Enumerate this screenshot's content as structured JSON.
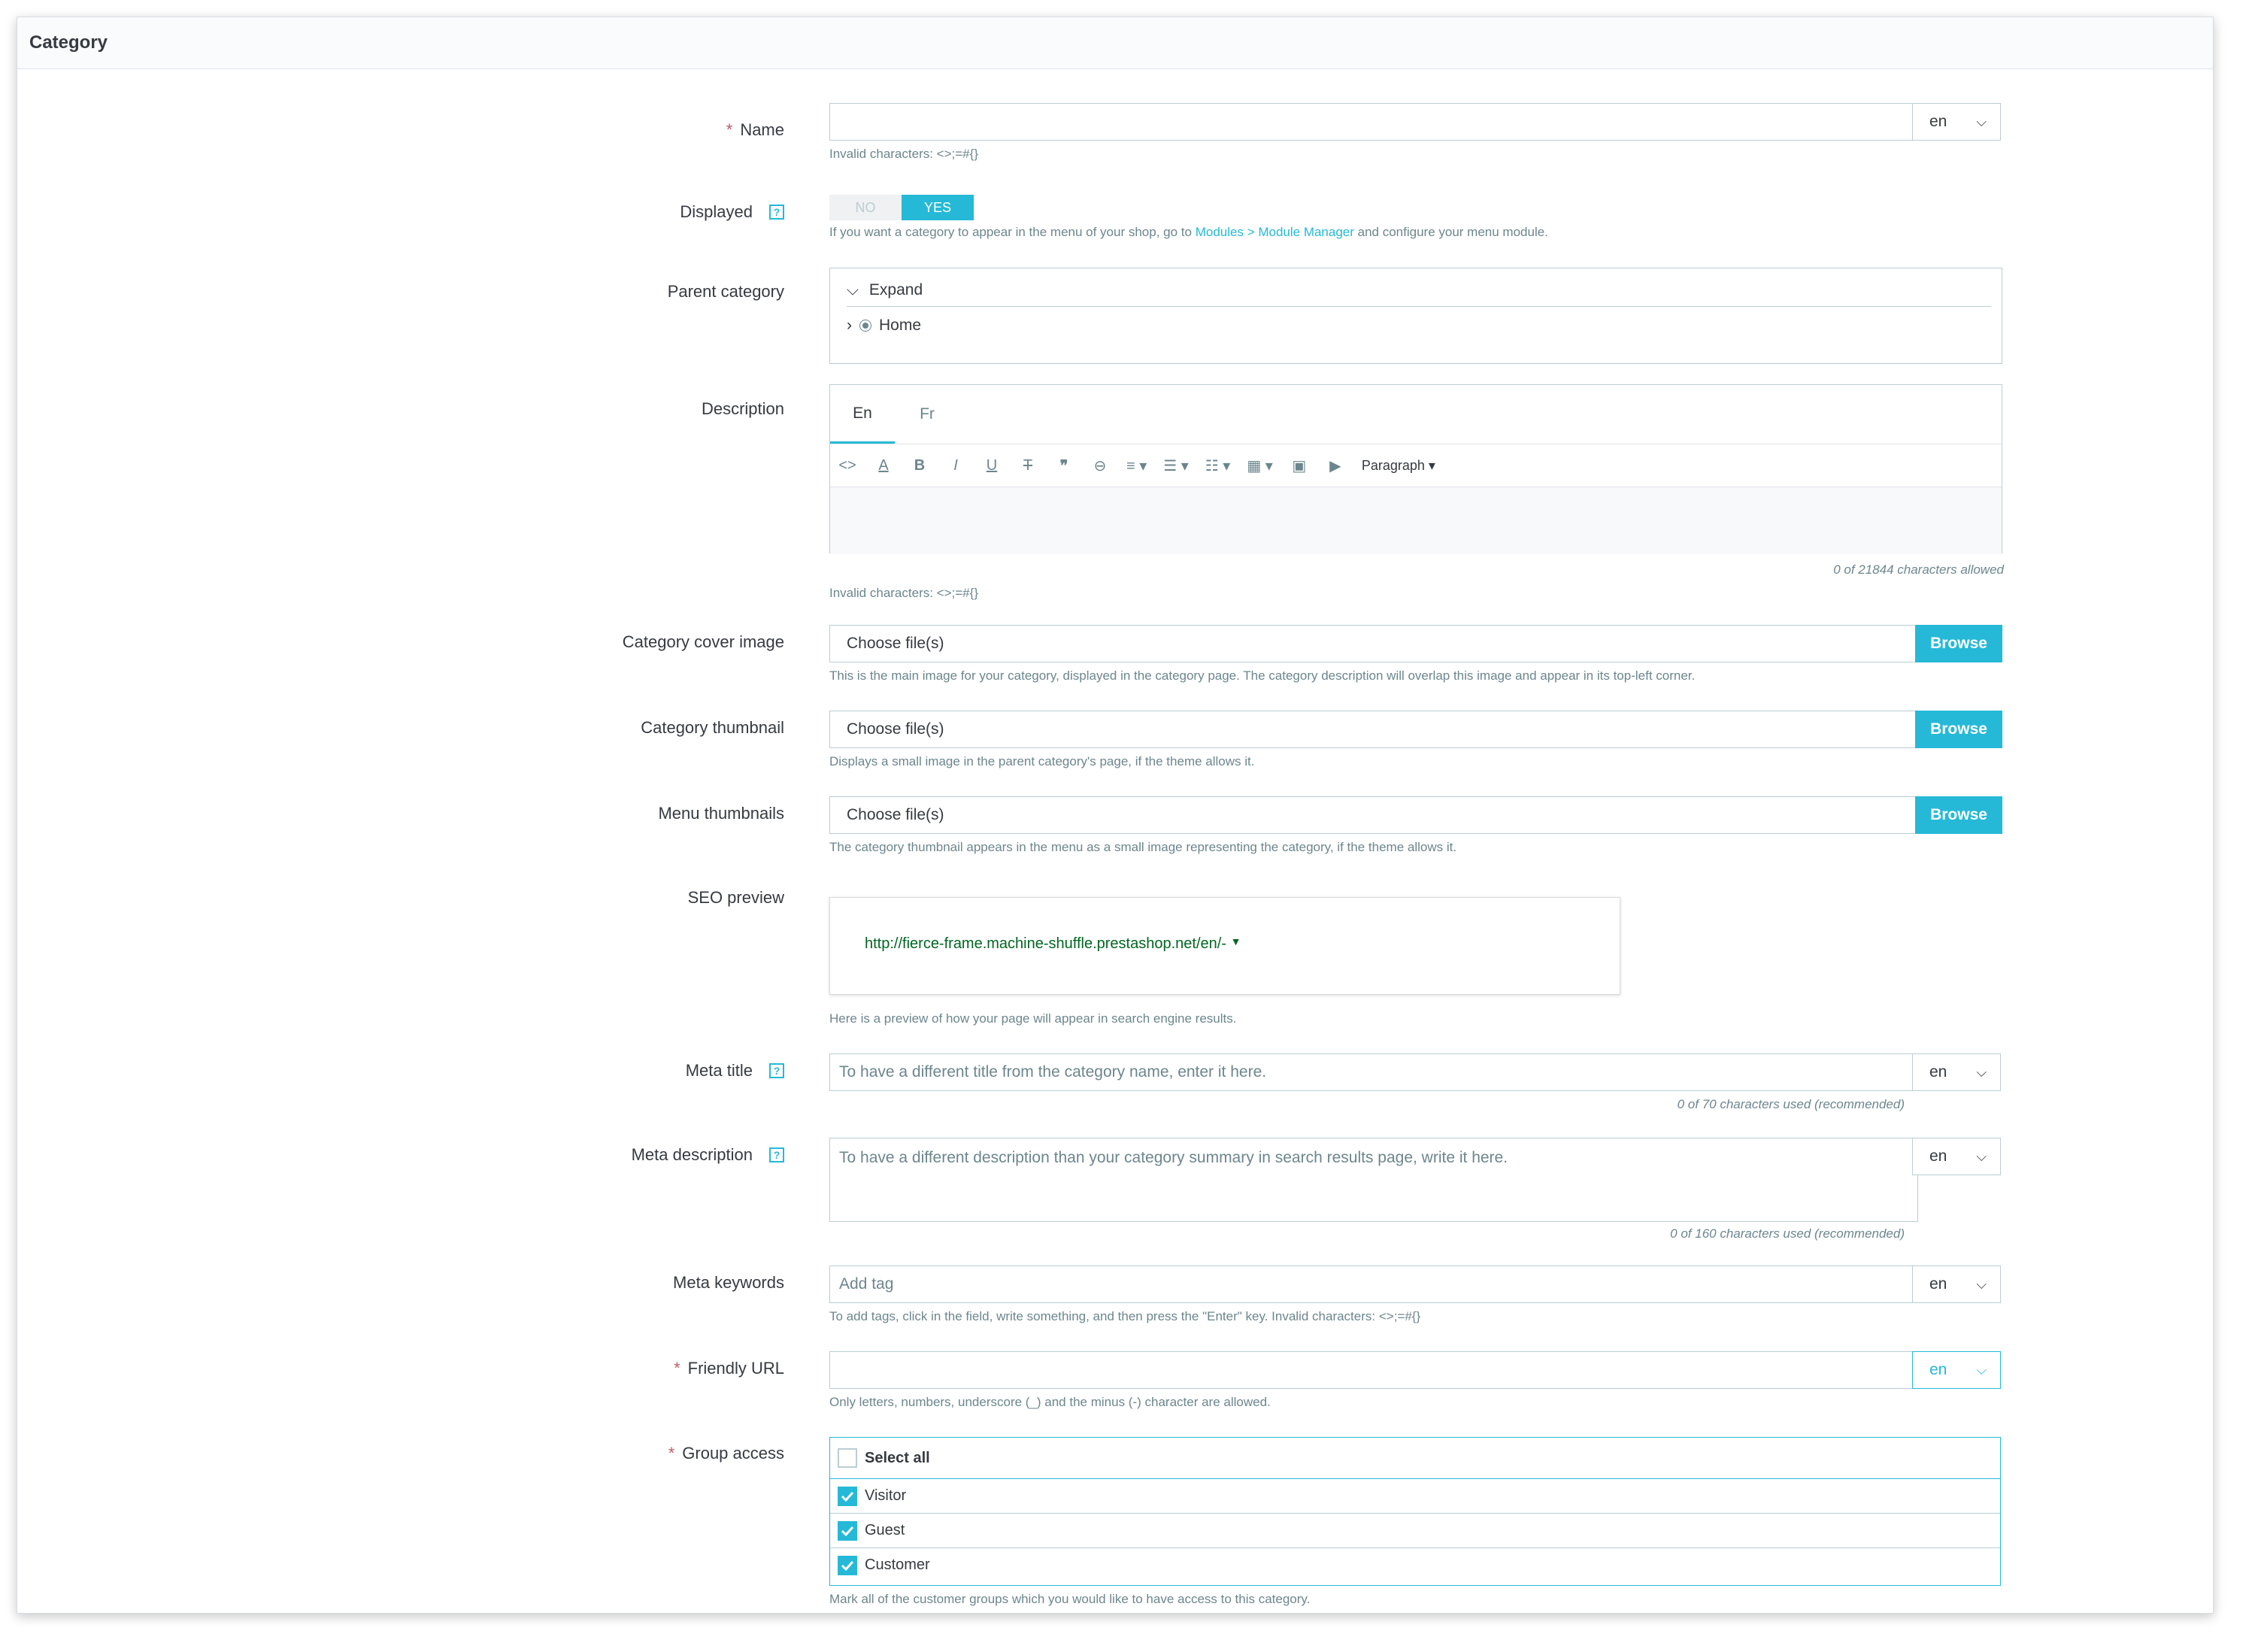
{
  "panel": {
    "title": "Category"
  },
  "name": {
    "label": "Name",
    "value": "",
    "lang": "en",
    "hint": "Invalid characters: <>;=#{}"
  },
  "displayed": {
    "label": "Displayed",
    "no_label": "NO",
    "yes_label": "YES",
    "selected": "YES",
    "hint_before": "If you want a category to appear in the menu of your shop, go to ",
    "hint_link": "Modules > Module Manager",
    "hint_after": " and configure your menu module."
  },
  "parent_category": {
    "label": "Parent category",
    "expand_label": "Expand",
    "root_label": "Home"
  },
  "description": {
    "label": "Description",
    "tabs": [
      "En",
      "Fr"
    ],
    "active_tab": "En",
    "format_label": "Paragraph",
    "counter": "0 of 21844 characters allowed",
    "hint": "Invalid characters: <>;=#{}"
  },
  "cover_image": {
    "label": "Category cover image",
    "placeholder": "Choose file(s)",
    "button": "Browse",
    "hint": "This is the main image for your category, displayed in the category page. The category description will overlap this image and appear in its top-left corner."
  },
  "thumbnail": {
    "label": "Category thumbnail",
    "placeholder": "Choose file(s)",
    "button": "Browse",
    "hint": "Displays a small image in the parent category's page, if the theme allows it."
  },
  "menu_thumbnails": {
    "label": "Menu thumbnails",
    "placeholder": "Choose file(s)",
    "button": "Browse",
    "hint": "The category thumbnail appears in the menu as a small image representing the category, if the theme allows it."
  },
  "seo_preview": {
    "label": "SEO preview",
    "url": "http://fierce-frame.machine-shuffle.prestashop.net/en/-",
    "hint": "Here is a preview of how your page will appear in search engine results."
  },
  "meta_title": {
    "label": "Meta title",
    "placeholder": "To have a different title from the category name, enter it here.",
    "lang": "en",
    "counter": "0 of 70 characters used (recommended)"
  },
  "meta_description": {
    "label": "Meta description",
    "placeholder": "To have a different description than your category summary in search results page, write it here.",
    "lang": "en",
    "counter": "0 of 160 characters used (recommended)"
  },
  "meta_keywords": {
    "label": "Meta keywords",
    "placeholder": "Add tag",
    "lang": "en",
    "hint": "To add tags, click in the field, write something, and then press the \"Enter\" key. Invalid characters: <>;=#{}"
  },
  "friendly_url": {
    "label": "Friendly URL",
    "value": "",
    "lang": "en",
    "hint": "Only letters, numbers, underscore (_) and the minus (-) character are allowed."
  },
  "group_access": {
    "label": "Group access",
    "select_all": "Select all",
    "groups": [
      {
        "name": "Visitor",
        "checked": true
      },
      {
        "name": "Guest",
        "checked": true
      },
      {
        "name": "Customer",
        "checked": true
      }
    ],
    "hint": "Mark all of the customer groups which you would like to have access to this category."
  },
  "colors": {
    "accent": "#25b9d7",
    "required": "#c05c67",
    "seo_url": "#006621"
  }
}
